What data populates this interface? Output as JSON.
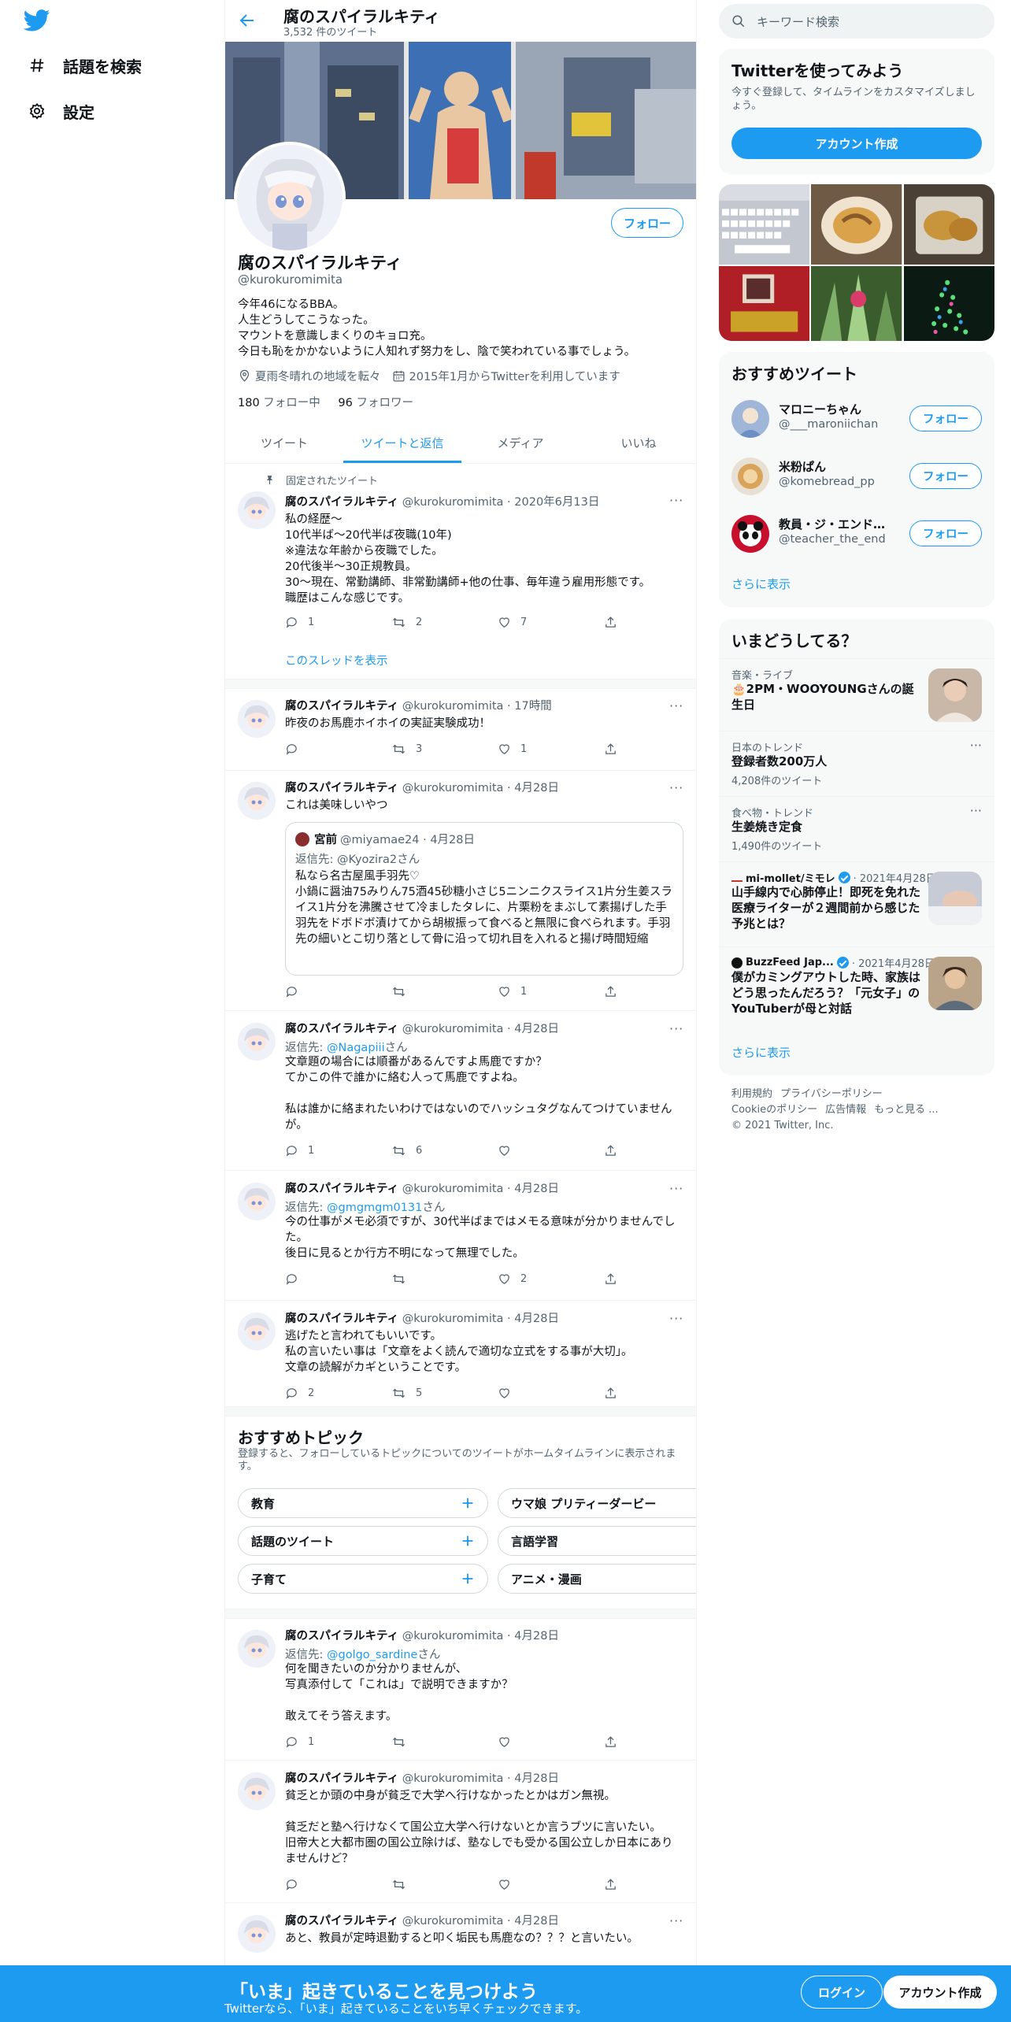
{
  "nav": {
    "explore_label": "話題を検索",
    "settings_label": "設定"
  },
  "header": {
    "title": "腐のスパイラルキティ",
    "tweet_count": "3,532 件のツイート"
  },
  "profile": {
    "follow_label": "フォロー",
    "name": "腐のスパイラルキティ",
    "handle": "@kurokuromimita",
    "bio": "今年46になるBBA。\n人生どうしてこうなった。\nマウントを意識しまくりのキョロ充。\n今日も恥をかかないように人知れず努力をし、陰で笑われている事でしょう。",
    "location": "夏雨冬晴れの地域を転々",
    "joined": "2015年1月からTwitterを利用しています",
    "following_count": "180",
    "following_label": "フォロー中",
    "followers_count": "96",
    "followers_label": "フォロワー"
  },
  "tabs": [
    "ツイート",
    "ツイートと返信",
    "メディア",
    "いいね"
  ],
  "pinned_label": "固定されたツイート",
  "tweets": [
    {
      "name": "腐のスパイラルキティ",
      "meta": "@kurokuromimita · 2020年6月13日",
      "text": "私の経歴〜\n10代半ば〜20代半ば夜職(10年)\n※違法な年齢から夜職でした。\n20代後半〜30正規教員。\n30〜現在、常勤講師、非常勤講師+他の仕事、毎年違う雇用形態です。\n職歴はこんな感じです。",
      "replies": "1",
      "retweets": "2",
      "likes": "7",
      "thread_link": "このスレッドを表示"
    },
    {
      "name": "腐のスパイラルキティ",
      "meta": "@kurokuromimita · 17時間",
      "text": "昨夜のお馬鹿ホイホイの実証実験成功！",
      "replies": "",
      "retweets": "3",
      "likes": "1"
    },
    {
      "name": "腐のスパイラルキティ",
      "meta": "@kurokuromimita · 4月28日",
      "text": "これは美味しいやつ",
      "replies": "",
      "retweets": "",
      "likes": "1",
      "quote": {
        "name": "宮前",
        "meta": "@miyamae24 · 4月28日",
        "reply_prefix": "返信先: ",
        "reply_to": "@Kyozira2さん",
        "text": "私なら名古屋風手羽先♡\n小鍋に醤油75みりん75酒45砂糖小さじ5ニンニクスライス1片分生姜スライス1片分を沸騰させて冷ましたタレに、片栗粉をまぶして素揚げした手羽先をドボドボ漬けてから胡椒振って食べると無限に食べられます。手羽先の細いとこ切り落として骨に沿って切れ目を入れると揚げ時間短縮"
      }
    },
    {
      "name": "腐のスパイラルキティ",
      "meta": "@kurokuromimita · 4月28日",
      "reply_prefix": "返信先: ",
      "reply_to": "@Nagapiii",
      "reply_suffix": "さん",
      "text": "文章題の場合には順番があるんですよ馬鹿ですか？\nてかこの件で誰かに絡む人って馬鹿ですよね。\n\n私は誰かに絡まれたいわけではないのでハッシュタグなんてつけていませんが。",
      "replies": "1",
      "retweets": "6",
      "likes": ""
    },
    {
      "name": "腐のスパイラルキティ",
      "meta": "@kurokuromimita · 4月28日",
      "reply_prefix": "返信先: ",
      "reply_to": "@gmgmgm0131",
      "reply_suffix": "さん",
      "text": "今の仕事がメモ必須ですが、30代半ばまではメモる意味が分かりませんでした。\n後日に見るとか行方不明になって無理でした。",
      "replies": "",
      "retweets": "",
      "likes": "2"
    },
    {
      "name": "腐のスパイラルキティ",
      "meta": "@kurokuromimita · 4月28日",
      "text": "逃げたと言われてもいいです。\n私の言いたい事は「文章をよく読んで適切な立式をする事が大切」。\n文章の読解がカギということです。",
      "replies": "2",
      "retweets": "5",
      "likes": ""
    },
    {
      "name": "腐のスパイラルキティ",
      "meta": "@kurokuromimita · 4月28日",
      "reply_prefix": "返信先: ",
      "reply_to": "@golgo_sardine",
      "reply_suffix": "さん",
      "text": "何を聞きたいのか分かりませんが、\n写真添付して「これは」で説明できますか？\n\n敢えてそう答えます。",
      "replies": "1",
      "retweets": "",
      "likes": ""
    },
    {
      "name": "腐のスパイラルキティ",
      "meta": "@kurokuromimita · 4月28日",
      "text": "貧乏とか頭の中身が貧乏で大学へ行けなかったとかはガン無視。\n\n貧乏だと塾へ行けなくて国公立大学へ行けないとか言うブツに言いたい。\n旧帝大と大都市圏の国公立除けば、塾なしでも受かる国公立しか日本にありませんけど？",
      "replies": "",
      "retweets": "",
      "likes": ""
    },
    {
      "name": "腐のスパイラルキティ",
      "meta": "@kurokuromimita · 4月28日",
      "text": "あと、教員が定時退勤すると叩く垢民も馬鹿なの？？？と言いたい。"
    }
  ],
  "topics": {
    "title": "おすすめトピック",
    "subtitle": "登録すると、フォローしているトピックについてのツイートがホームタイムラインに表示されます。",
    "items": [
      "教育",
      "ウマ娘 プリティーダービー",
      "話題のツイート",
      "言語学習",
      "子育て",
      "アニメ・漫画"
    ]
  },
  "right": {
    "search_placeholder": "キーワード検索",
    "signup_title": "Twitterを使ってみよう",
    "signup_sub": "今すぐ登録して、タイムラインをカスタマイズしましょう。",
    "signup_button": "アカウント作成",
    "rec_title": "おすすめツイート",
    "rec_users": [
      {
        "name": "マロニーちゃん",
        "handle": "@___maroniichan",
        "follow": "フォロー"
      },
      {
        "name": "米粉ぱん",
        "handle": "@komebread_pp",
        "follow": "フォロー"
      },
      {
        "name": "教員・ジ・エンド@...",
        "handle": "@teacher_the_end",
        "follow": "フォロー"
      }
    ],
    "show_more": "さらに表示",
    "trends_title": "いまどうしてる？",
    "trends": [
      {
        "category": "音楽・ライブ",
        "name": "🎂2PM・WOOYOUNGさんの誕生日"
      },
      {
        "category": "日本のトレンド",
        "name": "登録者数200万人",
        "count": "4,208件のツイート"
      },
      {
        "category": "食べ物・トレンド",
        "name": "生姜焼き定食",
        "count": "1,490件のツイート"
      },
      {
        "source": "mi-mollet/ミモレ",
        "date": "· 2021年4月28日",
        "name": "山手線内で心肺停止！即死を免れた医療ライターが２週間前から感じた予兆とは？"
      },
      {
        "source": "BuzzFeed Jap...",
        "date": "· 2021年4月28日",
        "name": "僕がカミングアウトした時、家族はどう思ったんだろう？「元女子」のYouTuberが母と対話"
      }
    ],
    "trends_more": "さらに表示",
    "footer": [
      "利用規約",
      "プライバシーポリシー",
      "Cookieのポリシー",
      "広告情報",
      "もっと見る ...",
      "© 2021 Twitter, Inc."
    ]
  },
  "bottombar": {
    "title": "「いま」起きていることを見つけよう",
    "subtitle": "Twitterなら、「いま」起きていることをいち早くチェックできます。",
    "login": "ログイン",
    "signup": "アカウント作成"
  },
  "colors": {
    "accent": "#1d9bf0",
    "text": "#0f1419",
    "muted": "#536471"
  }
}
